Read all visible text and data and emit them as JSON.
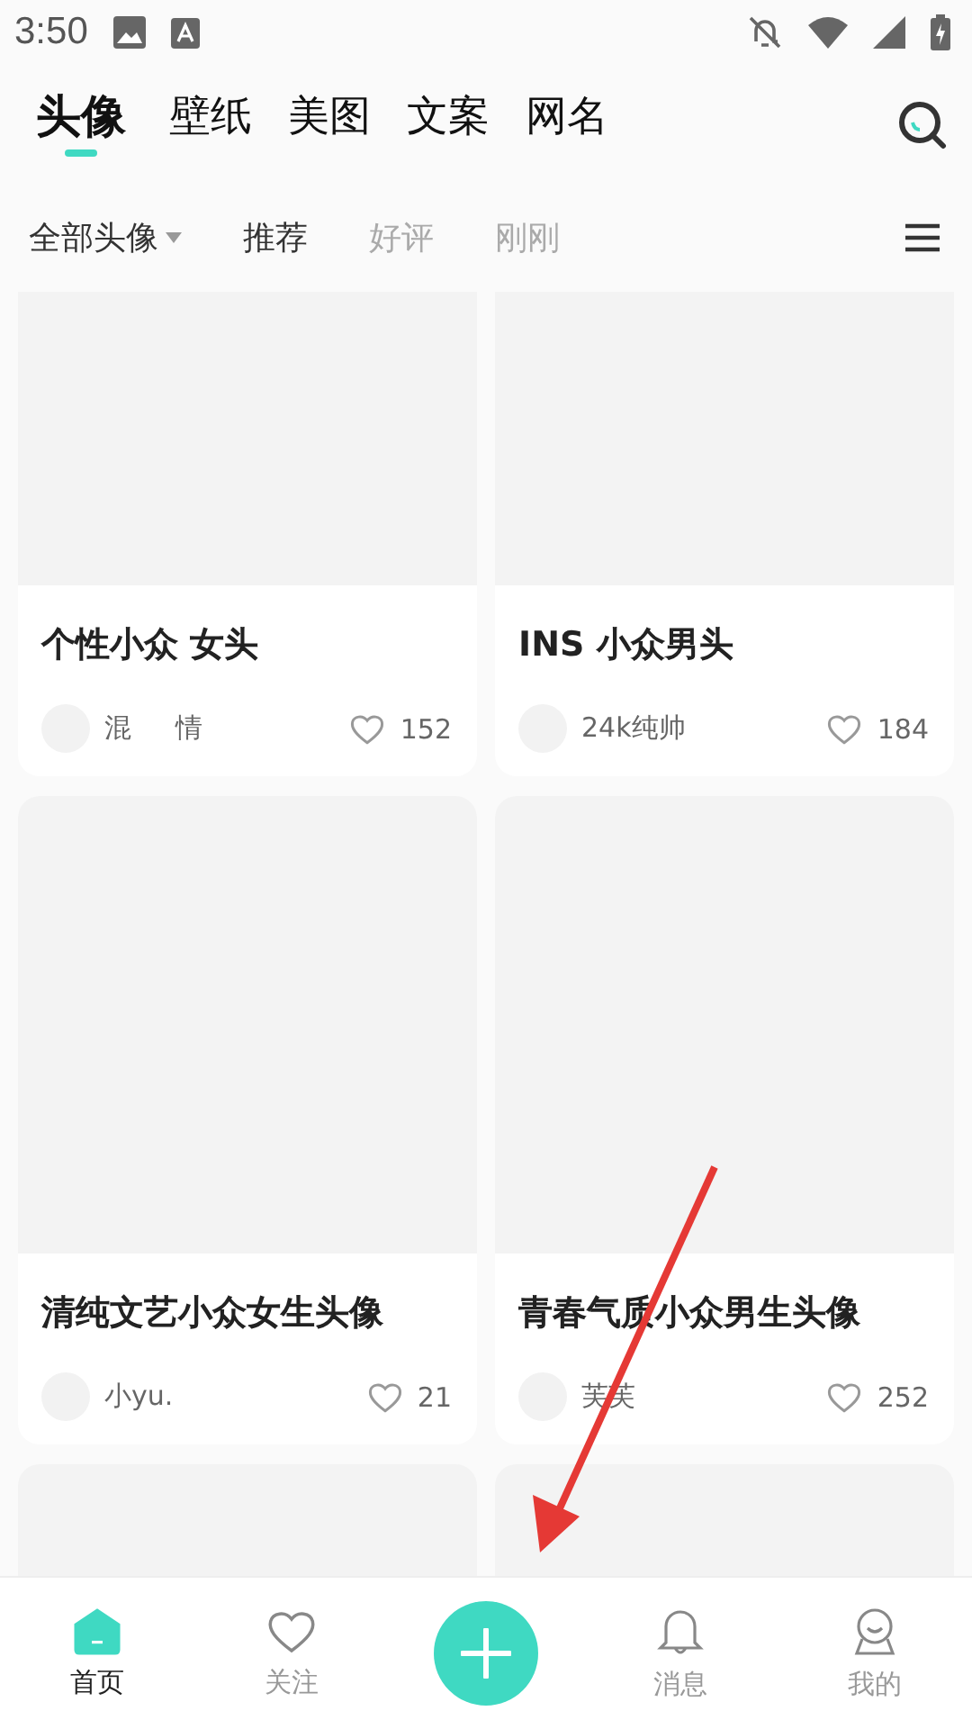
{
  "status_bar": {
    "time": "3:50"
  },
  "tabs": [
    {
      "label": "头像",
      "selected": true
    },
    {
      "label": "壁纸",
      "selected": false
    },
    {
      "label": "美图",
      "selected": false
    },
    {
      "label": "文案",
      "selected": false
    },
    {
      "label": "网名",
      "selected": false
    }
  ],
  "filters": [
    {
      "label": "全部头像",
      "kind": "dropdown"
    },
    {
      "label": "推荐",
      "kind": "plain",
      "selected": true
    },
    {
      "label": "好评",
      "kind": "plain",
      "selected": false
    },
    {
      "label": "刚刚",
      "kind": "plain",
      "selected": false
    }
  ],
  "cards": [
    {
      "kind": "full",
      "title": "个性小众 女头",
      "author": "混　  情",
      "likes": "152"
    },
    {
      "kind": "full",
      "title": "INS 小众男头",
      "author": "24k纯帅",
      "likes": "184"
    },
    {
      "kind": "full",
      "title": "清纯文艺小众女生头像",
      "author": "小yu.",
      "likes": "21"
    },
    {
      "kind": "full",
      "title": "青春气质小众男生头像",
      "author": "芙芙",
      "likes": "252"
    },
    {
      "kind": "image_only"
    },
    {
      "kind": "image_only"
    }
  ],
  "bottom_nav": [
    {
      "label": "首页",
      "kind": "home",
      "selected": true
    },
    {
      "label": "关注",
      "kind": "follow",
      "selected": false
    },
    {
      "kind": "add"
    },
    {
      "label": "消息",
      "kind": "messages",
      "selected": false
    },
    {
      "label": "我的",
      "kind": "profile",
      "selected": false
    }
  ]
}
